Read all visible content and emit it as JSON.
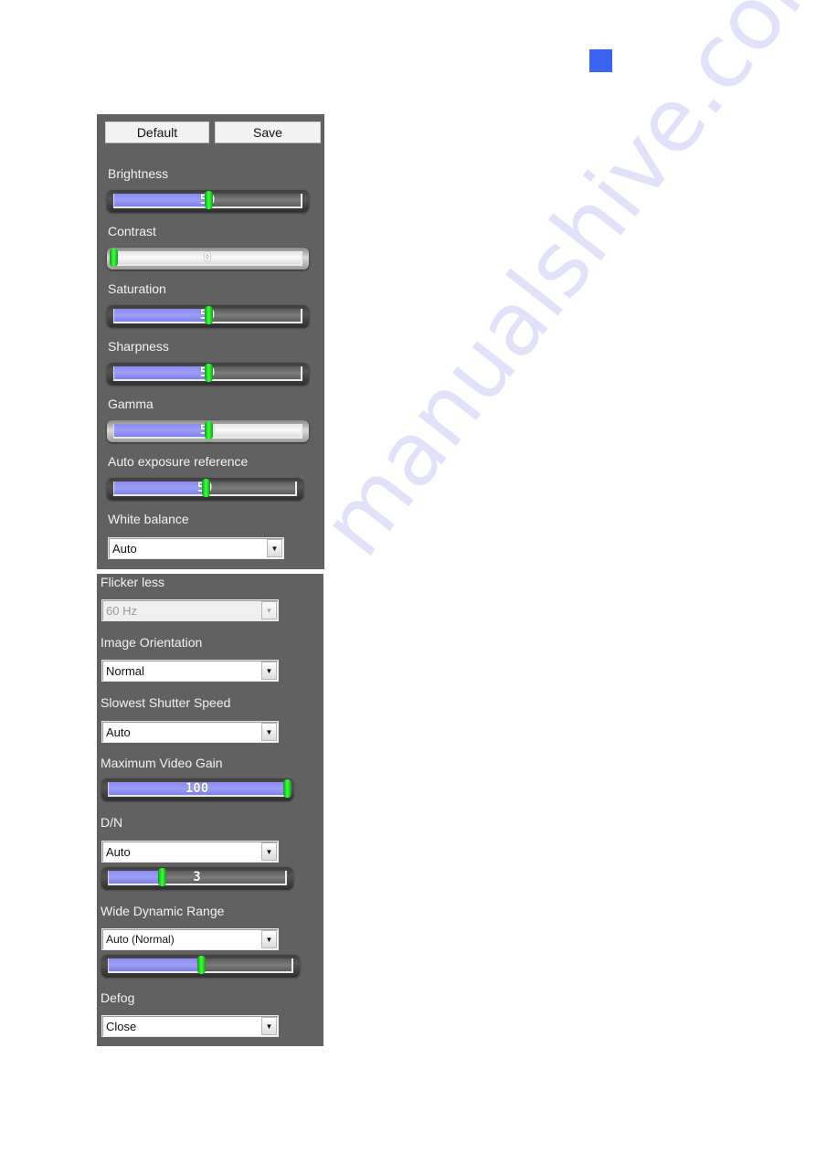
{
  "page": {
    "corner_tab_color": "#3b63f2",
    "watermark": "manualshive.com"
  },
  "panel1": {
    "buttons": {
      "default_label": "Default",
      "save_label": "Save"
    },
    "sliders": [
      {
        "id": "brightness",
        "label": "Brightness",
        "value": "50",
        "fraction": 0.5,
        "style": "dark"
      },
      {
        "id": "contrast",
        "label": "Contrast",
        "value": "0",
        "fraction": 0.0,
        "style": "light"
      },
      {
        "id": "saturation",
        "label": "Saturation",
        "value": "50",
        "fraction": 0.5,
        "style": "dark"
      },
      {
        "id": "sharpness",
        "label": "Sharpness",
        "value": "50",
        "fraction": 0.5,
        "style": "dark"
      },
      {
        "id": "gamma",
        "label": "Gamma",
        "value": "50",
        "fraction": 0.5,
        "style": "light"
      },
      {
        "id": "auto-exposure-reference",
        "label": "Auto exposure reference",
        "value": "50",
        "fraction": 0.5,
        "style": "dark"
      }
    ],
    "white_balance": {
      "label": "White balance",
      "value": "Auto"
    }
  },
  "panel2": {
    "flicker_less": {
      "label": "Flicker less",
      "value": "60 Hz",
      "disabled": true
    },
    "image_orientation": {
      "label": "Image Orientation",
      "value": "Normal"
    },
    "slowest_shutter_speed": {
      "label": "Slowest Shutter Speed",
      "value": "Auto"
    },
    "max_video_gain": {
      "label": "Maximum Video Gain",
      "value": "100",
      "fraction": 1.0
    },
    "dn": {
      "label": "D/N",
      "value": "Auto",
      "slider_value": "3",
      "fraction": 0.3
    },
    "wdr": {
      "label": "Wide Dynamic Range",
      "value": "Auto (Normal)",
      "slider_value": "5",
      "fraction": 0.5
    },
    "defog": {
      "label": "Defog",
      "value": "Close"
    }
  }
}
